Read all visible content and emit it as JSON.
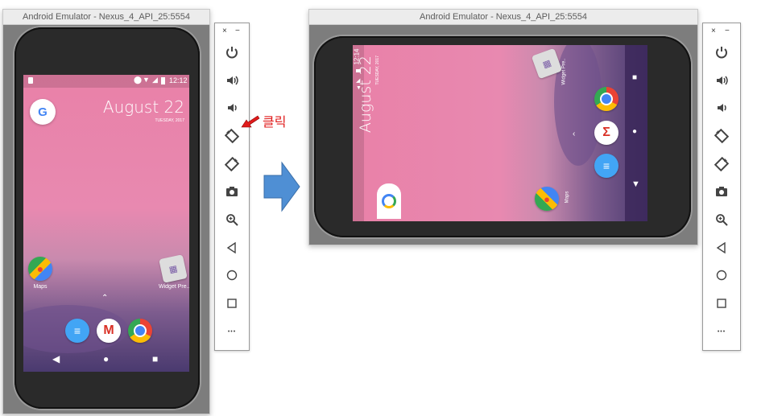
{
  "left": {
    "window_title": "Android Emulator - Nexus_4_API_25:5554",
    "status_time": "12:12",
    "date": "August 22",
    "weekday": "TUESDAY, 2017",
    "google_letter": "G",
    "apps": [
      {
        "label": "Maps"
      },
      {
        "label": "Widget Pre.."
      }
    ],
    "dock": [
      "Messages",
      "Gmail",
      "Chrome"
    ]
  },
  "annotation": {
    "label": "클릭"
  },
  "right": {
    "window_title": "Android Emulator - Nexus_4_API_25:5554",
    "status_time": "12:14",
    "date": "August 22",
    "weekday": "TUESDAY, 2017",
    "apps": [
      {
        "label": "Maps"
      },
      {
        "label": "Widget Pre.."
      }
    ]
  },
  "toolbar": {
    "close_glyph": "×",
    "minimize_glyph": "−",
    "more_glyph": "•••",
    "buttons": [
      "power",
      "volume-up",
      "volume-down",
      "rotate-left",
      "rotate-right",
      "screenshot",
      "zoom",
      "back",
      "home",
      "overview",
      "more"
    ]
  },
  "colors": {
    "wallpaper_top": "#e981a8",
    "wallpaper_bottom": "#4a3a6f",
    "arrow_blue": "#4f8fd4",
    "annotation_red": "#e01b1b"
  }
}
